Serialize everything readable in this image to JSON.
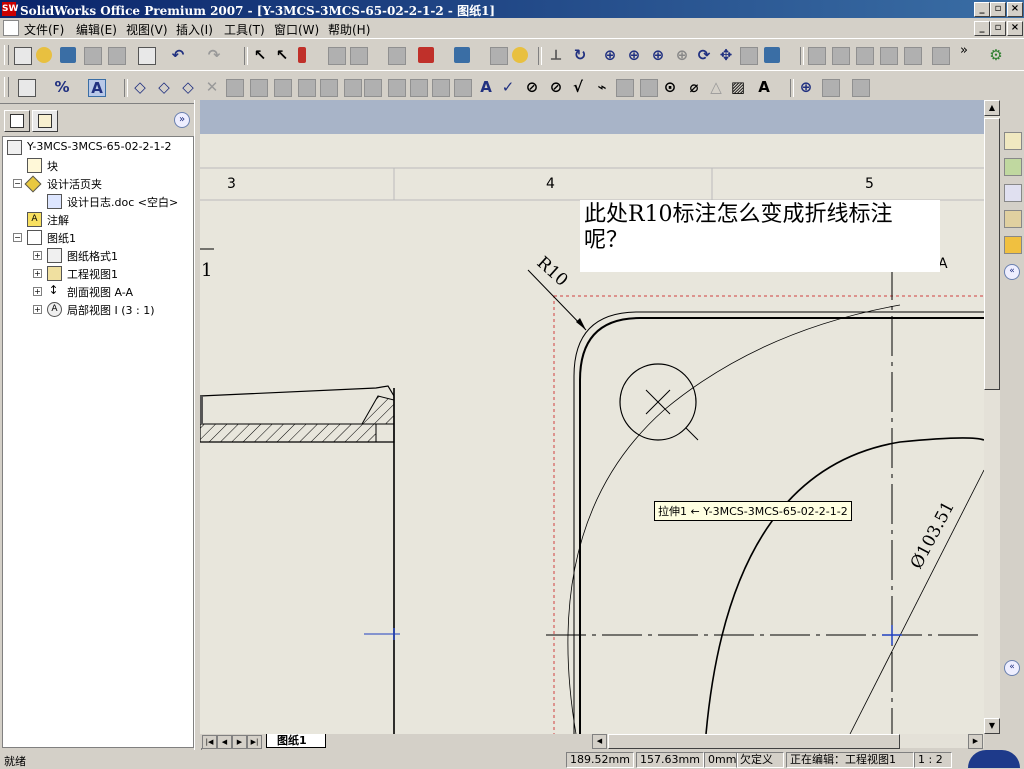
{
  "window": {
    "title": "SolidWorks Office Premium 2007 - [Y-3MCS-3MCS-65-02-2-1-2 - 图纸1]",
    "app_icon": "SW",
    "min": "_",
    "max": "▫",
    "close": "×"
  },
  "menu": [
    "文件(F)",
    "编辑(E)",
    "视图(V)",
    "插入(I)",
    "工具(T)",
    "窗口(W)",
    "帮助(H)"
  ],
  "toolbar_overflow": "»",
  "tree": {
    "root": "Y-3MCS-3MCS-65-02-2-1-2",
    "items": [
      {
        "label": "块",
        "icon": "block-icon"
      },
      {
        "label": "设计活页夹",
        "icon": "binder-icon",
        "expander": "−"
      },
      {
        "label": "设计日志.doc <空白>",
        "icon": "doc-icon"
      },
      {
        "label": "注解",
        "icon": "annotation-icon"
      },
      {
        "label": "图纸1",
        "icon": "sheet-icon",
        "expander": "−"
      },
      {
        "label": "图纸格式1",
        "icon": "sheet-format-icon",
        "expander": "+"
      },
      {
        "label": "工程视图1",
        "icon": "drawing-view-icon",
        "expander": "+"
      },
      {
        "label": "剖面视图 A-A",
        "icon": "section-view-icon",
        "expander": "+"
      },
      {
        "label": "局部视图 I (3 : 1)",
        "icon": "detail-view-icon",
        "expander": "+"
      }
    ],
    "collapse_chevron": "»"
  },
  "drawing": {
    "zone_labels": [
      "3",
      "4",
      "5"
    ],
    "row_label": "1",
    "question_note": "此处R10标注怎么变成折线标注呢？",
    "radius_dim": "R10",
    "diameter_dim": "Ø103.51",
    "section_marker": "A",
    "tooltip": "拉伸1 ← Y-3MCS-3MCS-65-02-2-1-2"
  },
  "sheet_tab": "图纸1",
  "status": {
    "ready": "就绪",
    "x": "189.52mm",
    "y": "157.63mm",
    "z": "0mm",
    "defined": "欠定义",
    "editing": "正在编辑：工程视图1",
    "scale": "1 : 2"
  }
}
